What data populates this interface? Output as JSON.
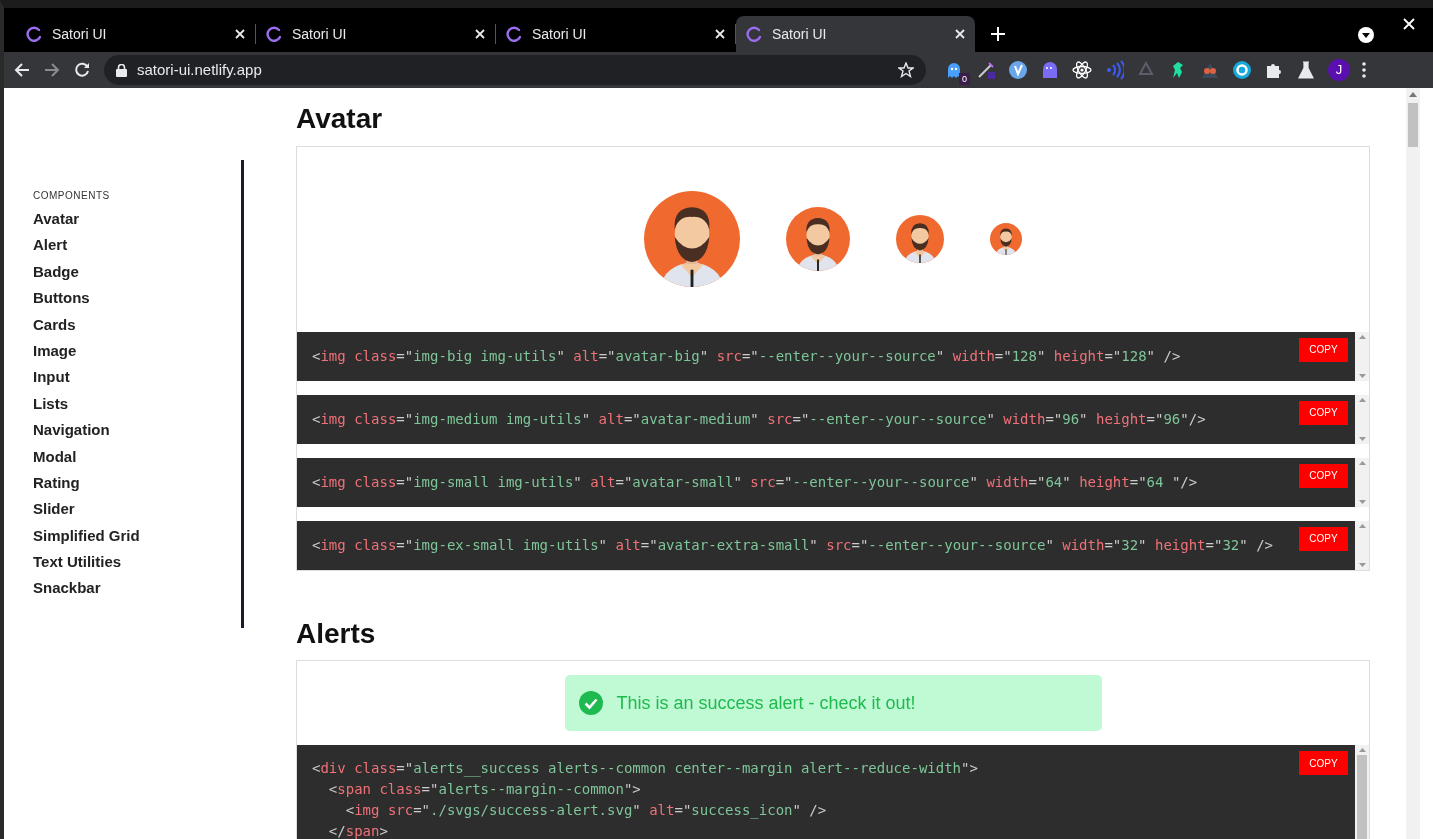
{
  "browser": {
    "tabs": [
      {
        "title": "Satori UI",
        "selected": false
      },
      {
        "title": "Satori UI",
        "selected": false
      },
      {
        "title": "Satori UI",
        "selected": false
      },
      {
        "title": "Satori UI",
        "selected": true
      }
    ],
    "address": "satori-ui.netlify.app",
    "extension_badge": "0",
    "profile_initial": "J"
  },
  "sidebar": {
    "heading": "COMPONENTS",
    "items": [
      "Avatar",
      "Alert",
      "Badge",
      "Buttons",
      "Cards",
      "Image",
      "Input",
      "Lists",
      "Navigation",
      "Modal",
      "Rating",
      "Slider",
      "Simplified Grid",
      "Text Utilities",
      "Snackbar"
    ]
  },
  "sections": [
    {
      "title": "Avatar",
      "kind": "avatars",
      "code_blocks": [
        {
          "button": "COPY",
          "lines": [
            [
              {
                "kind": "punct",
                "text": "<"
              },
              {
                "kind": "name",
                "text": "img"
              },
              {
                "kind": "name",
                "text": " class"
              },
              {
                "kind": "punct",
                "text": "=\""
              },
              {
                "kind": "value",
                "text": "img-big img-utils"
              },
              {
                "kind": "punct",
                "text": "\""
              },
              {
                "kind": "name",
                "text": " alt"
              },
              {
                "kind": "punct",
                "text": "=\""
              },
              {
                "kind": "value",
                "text": "avatar-big"
              },
              {
                "kind": "punct",
                "text": "\""
              },
              {
                "kind": "name",
                "text": " src"
              },
              {
                "kind": "punct",
                "text": "=\""
              },
              {
                "kind": "value",
                "text": "--enter--your--source"
              },
              {
                "kind": "punct",
                "text": "\""
              },
              {
                "kind": "name",
                "text": " width"
              },
              {
                "kind": "punct",
                "text": "=\""
              },
              {
                "kind": "value",
                "text": "128"
              },
              {
                "kind": "punct",
                "text": "\""
              },
              {
                "kind": "name",
                "text": " height"
              },
              {
                "kind": "punct",
                "text": "=\""
              },
              {
                "kind": "value",
                "text": "128"
              },
              {
                "kind": "punct",
                "text": "\" />"
              }
            ]
          ]
        },
        {
          "button": "COPY",
          "lines": [
            [
              {
                "kind": "punct",
                "text": "<"
              },
              {
                "kind": "name",
                "text": "img"
              },
              {
                "kind": "name",
                "text": " class"
              },
              {
                "kind": "punct",
                "text": "=\""
              },
              {
                "kind": "value",
                "text": "img-medium img-utils"
              },
              {
                "kind": "punct",
                "text": "\""
              },
              {
                "kind": "name",
                "text": " alt"
              },
              {
                "kind": "punct",
                "text": "=\""
              },
              {
                "kind": "value",
                "text": "avatar-medium"
              },
              {
                "kind": "punct",
                "text": "\""
              },
              {
                "kind": "name",
                "text": " src"
              },
              {
                "kind": "punct",
                "text": "=\""
              },
              {
                "kind": "value",
                "text": "--enter--your--source"
              },
              {
                "kind": "punct",
                "text": "\""
              },
              {
                "kind": "name",
                "text": " width"
              },
              {
                "kind": "punct",
                "text": "=\""
              },
              {
                "kind": "value",
                "text": "96"
              },
              {
                "kind": "punct",
                "text": "\""
              },
              {
                "kind": "name",
                "text": " height"
              },
              {
                "kind": "punct",
                "text": "=\""
              },
              {
                "kind": "value",
                "text": "96"
              },
              {
                "kind": "punct",
                "text": "\"/>"
              }
            ]
          ]
        },
        {
          "button": "COPY",
          "lines": [
            [
              {
                "kind": "punct",
                "text": "<"
              },
              {
                "kind": "name",
                "text": "img"
              },
              {
                "kind": "name",
                "text": " class"
              },
              {
                "kind": "punct",
                "text": "=\""
              },
              {
                "kind": "value",
                "text": "img-small img-utils"
              },
              {
                "kind": "punct",
                "text": "\""
              },
              {
                "kind": "name",
                "text": " alt"
              },
              {
                "kind": "punct",
                "text": "=\""
              },
              {
                "kind": "value",
                "text": "avatar-small"
              },
              {
                "kind": "punct",
                "text": "\""
              },
              {
                "kind": "name",
                "text": " src"
              },
              {
                "kind": "punct",
                "text": "=\""
              },
              {
                "kind": "value",
                "text": "--enter--your--source"
              },
              {
                "kind": "punct",
                "text": "\""
              },
              {
                "kind": "name",
                "text": " width"
              },
              {
                "kind": "punct",
                "text": "=\""
              },
              {
                "kind": "value",
                "text": "64"
              },
              {
                "kind": "punct",
                "text": "\""
              },
              {
                "kind": "name",
                "text": " height"
              },
              {
                "kind": "punct",
                "text": "=\""
              },
              {
                "kind": "value",
                "text": "64 "
              },
              {
                "kind": "punct",
                "text": "\"/>"
              }
            ]
          ]
        },
        {
          "button": "COPY",
          "lines": [
            [
              {
                "kind": "punct",
                "text": "<"
              },
              {
                "kind": "name",
                "text": "img"
              },
              {
                "kind": "name",
                "text": " class"
              },
              {
                "kind": "punct",
                "text": "=\""
              },
              {
                "kind": "value",
                "text": "img-ex-small img-utils"
              },
              {
                "kind": "punct",
                "text": "\""
              },
              {
                "kind": "name",
                "text": " alt"
              },
              {
                "kind": "punct",
                "text": "=\""
              },
              {
                "kind": "value",
                "text": "avatar-extra-small"
              },
              {
                "kind": "punct",
                "text": "\""
              },
              {
                "kind": "name",
                "text": " src"
              },
              {
                "kind": "punct",
                "text": "=\""
              },
              {
                "kind": "value",
                "text": "--enter--your--source"
              },
              {
                "kind": "punct",
                "text": "\""
              },
              {
                "kind": "name",
                "text": " width"
              },
              {
                "kind": "punct",
                "text": "=\""
              },
              {
                "kind": "value",
                "text": "32"
              },
              {
                "kind": "punct",
                "text": "\""
              },
              {
                "kind": "name",
                "text": " height"
              },
              {
                "kind": "punct",
                "text": "=\""
              },
              {
                "kind": "value",
                "text": "32"
              },
              {
                "kind": "punct",
                "text": "\" />"
              }
            ]
          ]
        }
      ]
    },
    {
      "title": "Alerts",
      "kind": "alert",
      "alert": {
        "kind": "success",
        "text": "This is an success alert - check it out!"
      },
      "code_blocks": [
        {
          "button": "COPY",
          "lines": [
            [
              {
                "kind": "punct",
                "text": "<"
              },
              {
                "kind": "name",
                "text": "div"
              },
              {
                "kind": "name",
                "text": " class"
              },
              {
                "kind": "punct",
                "text": "=\""
              },
              {
                "kind": "value",
                "text": "alerts__success alerts--common center--margin alert--reduce-width"
              },
              {
                "kind": "punct",
                "text": "\">"
              }
            ],
            [
              {
                "kind": "punct",
                "text": "  <"
              },
              {
                "kind": "name",
                "text": "span"
              },
              {
                "kind": "name",
                "text": " class"
              },
              {
                "kind": "punct",
                "text": "=\""
              },
              {
                "kind": "value",
                "text": "alerts--margin--common"
              },
              {
                "kind": "punct",
                "text": "\">"
              }
            ],
            [
              {
                "kind": "punct",
                "text": "    <"
              },
              {
                "kind": "name",
                "text": "img"
              },
              {
                "kind": "name",
                "text": " src"
              },
              {
                "kind": "punct",
                "text": "=\""
              },
              {
                "kind": "value",
                "text": "./svgs/success-alert.svg"
              },
              {
                "kind": "punct",
                "text": "\""
              },
              {
                "kind": "name",
                "text": " alt"
              },
              {
                "kind": "punct",
                "text": "=\""
              },
              {
                "kind": "value",
                "text": "success_icon"
              },
              {
                "kind": "punct",
                "text": "\" />"
              }
            ],
            [
              {
                "kind": "punct",
                "text": "  </"
              },
              {
                "kind": "name",
                "text": "span"
              },
              {
                "kind": "punct",
                "text": ">"
              }
            ]
          ]
        }
      ]
    }
  ]
}
